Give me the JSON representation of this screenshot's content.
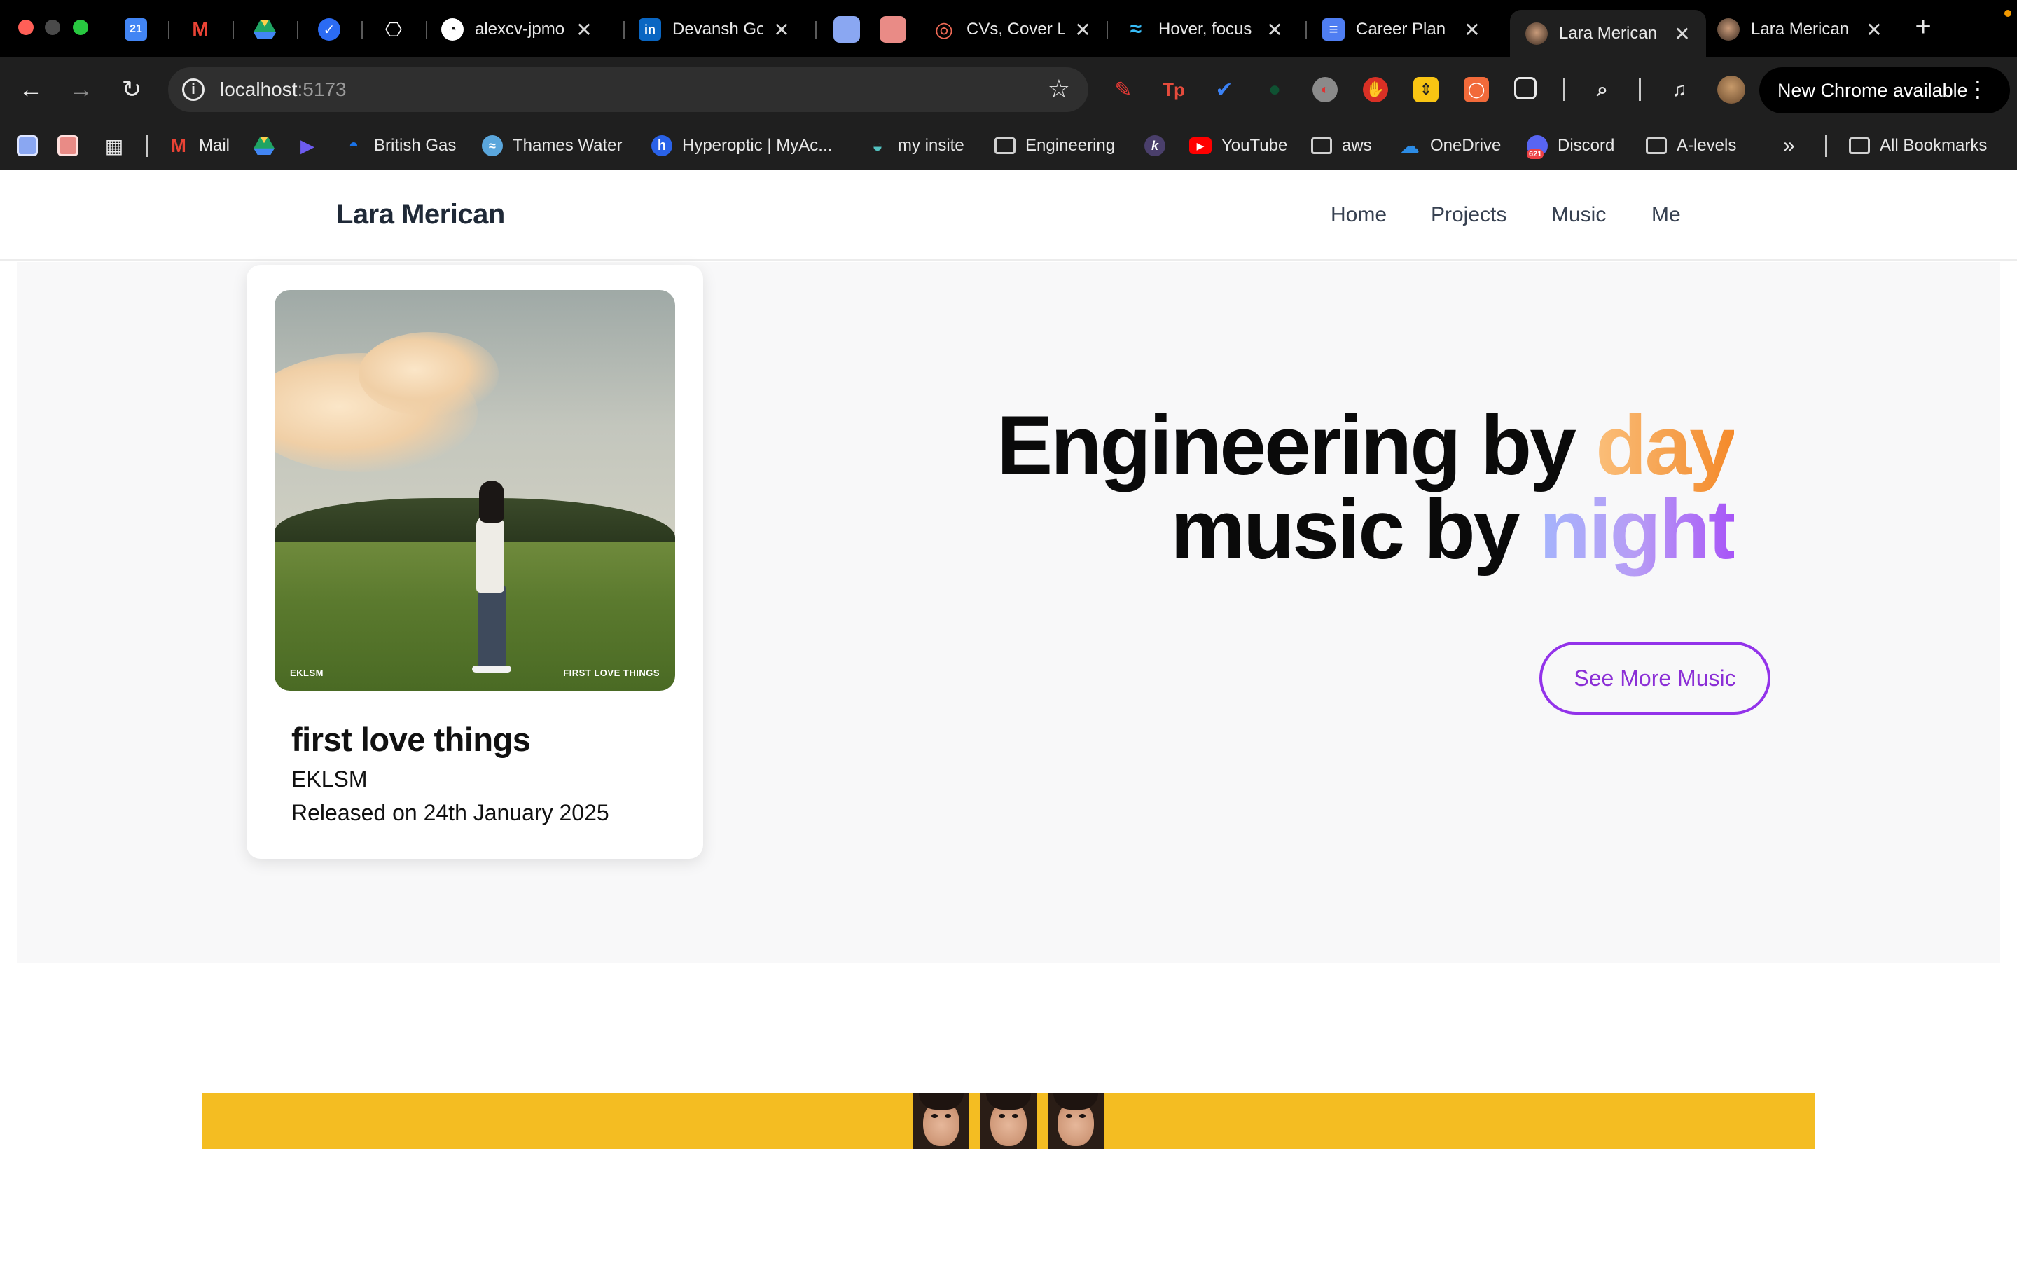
{
  "browser": {
    "tabs": [
      {
        "title": "",
        "icon": "google-calendar-icon"
      },
      {
        "title": "",
        "icon": "gmail-icon"
      },
      {
        "title": "",
        "icon": "google-drive-icon"
      },
      {
        "title": "",
        "icon": "checkmark-app-icon"
      },
      {
        "title": "",
        "icon": "openai-icon"
      },
      {
        "title": "alexcv-jpmo",
        "icon": "web-icon"
      },
      {
        "title": "Devansh Go",
        "icon": "linkedin-icon"
      },
      {
        "title": "",
        "icon": "blue-square-icon"
      },
      {
        "title": "",
        "icon": "red-square-icon"
      },
      {
        "title": "CVs, Cover L",
        "icon": "target-icon"
      },
      {
        "title": "Hover, focus",
        "icon": "tailwind-icon"
      },
      {
        "title": "Career Plan",
        "icon": "google-docs-icon"
      },
      {
        "title": "Lara Merican",
        "icon": "avatar-icon"
      },
      {
        "title": "Lara Merican",
        "icon": "avatar-icon"
      }
    ],
    "address": {
      "host": "localhost",
      "port": ":5173"
    },
    "update_label": "New Chrome available",
    "bookmarks": [
      {
        "label": "Mail",
        "icon": "gmail-icon"
      },
      {
        "label": "",
        "icon": "google-drive-icon"
      },
      {
        "label": "",
        "icon": "power-automate-icon"
      },
      {
        "label": "British Gas",
        "icon": "british-gas-icon"
      },
      {
        "label": "Thames Water",
        "icon": "thames-water-icon"
      },
      {
        "label": "Hyperoptic | MyAc...",
        "icon": "hyperoptic-icon"
      },
      {
        "label": "my insite",
        "icon": "insite-icon"
      },
      {
        "label": "Engineering",
        "icon": "folder-icon"
      },
      {
        "label": "",
        "icon": "k-icon"
      },
      {
        "label": "YouTube",
        "icon": "youtube-icon"
      },
      {
        "label": "aws",
        "icon": "folder-icon"
      },
      {
        "label": "OneDrive",
        "icon": "onedrive-icon"
      },
      {
        "label": "Discord",
        "icon": "discord-icon"
      },
      {
        "label": "A-levels",
        "icon": "folder-icon"
      },
      {
        "label": "All Bookmarks",
        "icon": "folder-icon"
      }
    ],
    "discord_badge": "621"
  },
  "site": {
    "brand": "Lara Merican",
    "nav": [
      "Home",
      "Projects",
      "Music",
      "Me"
    ]
  },
  "release": {
    "title": "first love things",
    "artist": "EKLSM",
    "date": "Released on 24th January 2025",
    "cover_label_left": "EKLSM",
    "cover_label_right": "FIRST LOVE THINGS"
  },
  "hero": {
    "line1_prefix": "Engineering by ",
    "line1_accent": "day",
    "line2_prefix": "music by ",
    "line2_accent": "night",
    "cta": "See More Music"
  },
  "colors": {
    "strip": "#f4bd22",
    "cta": "#9333ea",
    "day_gradient": [
      "#fbbf7a",
      "#f58a2a"
    ],
    "night_gradient": [
      "#a5b4fc",
      "#a855f7"
    ]
  }
}
